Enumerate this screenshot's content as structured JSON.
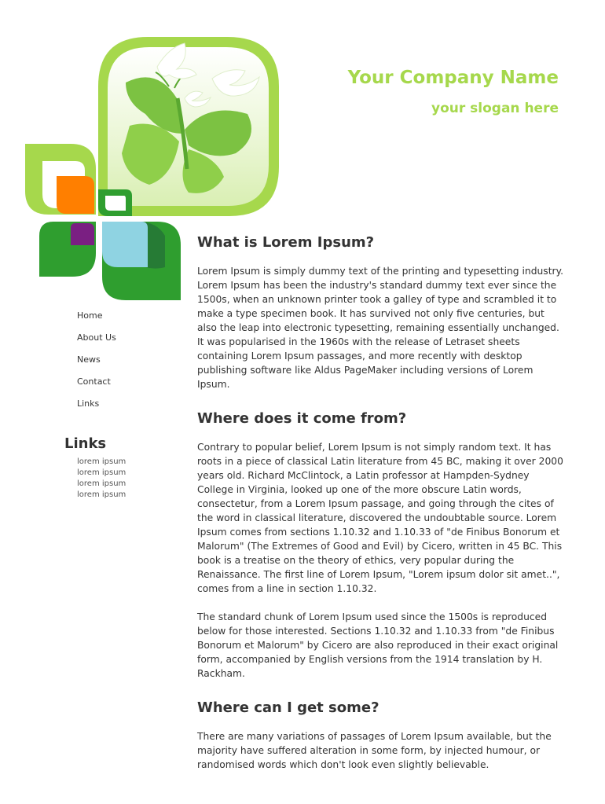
{
  "header": {
    "company_name": "Your Company Name",
    "slogan": "your slogan here"
  },
  "colors": {
    "brand_green": "#a6d84c",
    "dark_green": "#2f9e2f",
    "orange": "#ff7f00",
    "purple": "#7a1f82",
    "light_blue": "#8fd3e2",
    "text": "#333333"
  },
  "nav": {
    "items": [
      {
        "label": "Home"
      },
      {
        "label": "About Us"
      },
      {
        "label": "News"
      },
      {
        "label": "Contact"
      },
      {
        "label": "Links"
      }
    ]
  },
  "links": {
    "title": "Links",
    "items": [
      "lorem ipsum",
      "lorem ipsum",
      "lorem ipsum",
      "lorem ipsum"
    ]
  },
  "content": {
    "sections": [
      {
        "heading": "What is Lorem Ipsum?",
        "paragraphs": [
          "Lorem Ipsum is simply dummy text of the printing and typesetting industry. Lorem Ipsum has been the industry's standard dummy text ever since the 1500s, when an unknown printer took a galley of type and scrambled it to make a type specimen book. It has survived not only five centuries, but also the leap into electronic typesetting, remaining essentially unchanged. It was popularised in the 1960s with the release of Letraset sheets containing Lorem Ipsum passages, and more recently with desktop publishing software like Aldus PageMaker including versions of Lorem Ipsum."
        ]
      },
      {
        "heading": "Where does it come from?",
        "paragraphs": [
          "Contrary to popular belief, Lorem Ipsum is not simply random text. It has roots in a piece of classical Latin literature from 45 BC, making it over 2000 years old. Richard McClintock, a Latin professor at Hampden-Sydney College in Virginia, looked up one of the more obscure Latin words, consectetur, from a Lorem Ipsum passage, and going through the cites of the word in classical literature, discovered the undoubtable source. Lorem Ipsum comes from sections 1.10.32 and 1.10.33 of \"de Finibus Bonorum et Malorum\" (The Extremes of Good and Evil) by Cicero, written in 45 BC. This book is a treatise on the theory of ethics, very popular during the Renaissance. The first line of Lorem Ipsum, \"Lorem ipsum dolor sit amet..\", comes from a line in section 1.10.32.",
          "The standard chunk of Lorem Ipsum used since the 1500s is reproduced below for those interested. Sections 1.10.32 and 1.10.33 from \"de Finibus Bonorum et Malorum\" by Cicero are also reproduced in their exact original form, accompanied by English versions from the 1914 translation by H. Rackham."
        ]
      },
      {
        "heading": "Where can I get some?",
        "paragraphs": [
          "There are many variations of passages of Lorem Ipsum available, but the majority have suffered alteration in some form, by injected humour, or randomised words which don't look even slightly believable."
        ]
      }
    ]
  },
  "logo": {
    "icon": "butterfly-leaf-logo"
  }
}
